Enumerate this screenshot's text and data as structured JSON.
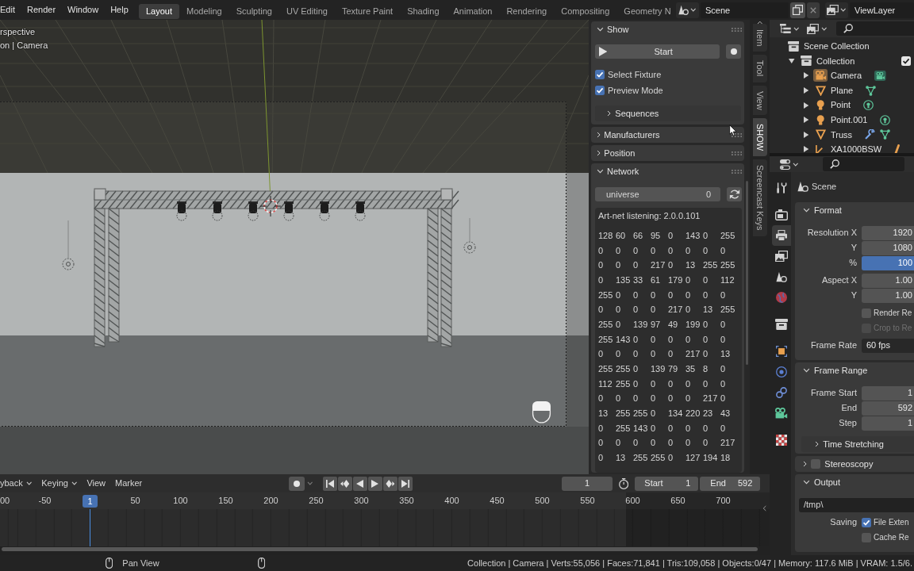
{
  "top_bar": {
    "menus": [
      "Edit",
      "Render",
      "Window",
      "Help"
    ],
    "workspaces": [
      {
        "label": "Layout",
        "selected": true
      },
      {
        "label": "Modeling",
        "selected": false
      },
      {
        "label": "Sculpting",
        "selected": false
      },
      {
        "label": "UV Editing",
        "selected": false
      },
      {
        "label": "Texture Paint",
        "selected": false
      },
      {
        "label": "Shading",
        "selected": false
      },
      {
        "label": "Animation",
        "selected": false
      },
      {
        "label": "Rendering",
        "selected": false
      },
      {
        "label": "Compositing",
        "selected": false
      },
      {
        "label": "Geometry N",
        "selected": false
      }
    ],
    "scene": "Scene",
    "view_layer": "ViewLayer"
  },
  "viewport": {
    "overlay_lines": [
      "rspective",
      "on | Camera"
    ]
  },
  "sidebar": {
    "panels": [
      {
        "title": "Show",
        "expanded": true,
        "button": "Start",
        "checkboxes": [
          {
            "label": "Select Fixture",
            "checked": true
          },
          {
            "label": "Preview Mode",
            "checked": true
          }
        ],
        "subpanels": [
          {
            "title": "Sequences",
            "expanded": false
          }
        ]
      },
      {
        "title": "Manufacturers",
        "expanded": false
      },
      {
        "title": "Position",
        "expanded": false
      },
      {
        "title": "Network",
        "expanded": true,
        "universe": {
          "label": "universe",
          "value": "0"
        },
        "status": "Art-net listening: 2.0.0.101",
        "channels": [
          [
            "128",
            "60",
            "66",
            "95",
            "0",
            "143",
            "0",
            "255"
          ],
          [
            "0",
            "0",
            "0",
            "0",
            "0",
            "0",
            "0",
            "0"
          ],
          [
            "0",
            "0",
            "0",
            "217",
            "0",
            "13",
            "255",
            "255"
          ],
          [
            "0",
            "135",
            "33",
            "61",
            "179",
            "0",
            "0",
            "112"
          ],
          [
            "255",
            "0",
            "0",
            "0",
            "0",
            "0",
            "0",
            "0"
          ],
          [
            "0",
            "0",
            "0",
            "0",
            "217",
            "0",
            "13",
            "255"
          ],
          [
            "255",
            "0",
            "139",
            "97",
            "49",
            "199",
            "0",
            "0"
          ],
          [
            "255",
            "143",
            "0",
            "0",
            "0",
            "0",
            "0",
            "0"
          ],
          [
            "0",
            "0",
            "0",
            "0",
            "0",
            "217",
            "0",
            "13"
          ],
          [
            "255",
            "255",
            "0",
            "139",
            "79",
            "35",
            "8",
            "0"
          ],
          [
            "112",
            "255",
            "0",
            "0",
            "0",
            "0",
            "0",
            "0"
          ],
          [
            "0",
            "0",
            "0",
            "0",
            "0",
            "0",
            "217",
            "0"
          ],
          [
            "13",
            "255",
            "255",
            "0",
            "134",
            "220",
            "23",
            "43"
          ],
          [
            "0",
            "255",
            "143",
            "0",
            "0",
            "0",
            "0",
            "0"
          ],
          [
            "0",
            "0",
            "0",
            "0",
            "0",
            "0",
            "0",
            "217"
          ],
          [
            "0",
            "13",
            "255",
            "255",
            "0",
            "127",
            "194",
            "18"
          ]
        ]
      }
    ],
    "tabs": [
      {
        "label": "Item",
        "selected": false
      },
      {
        "label": "Tool",
        "selected": false
      },
      {
        "label": "View",
        "selected": false
      },
      {
        "label": "SHOW",
        "selected": true
      },
      {
        "label": "Screencast Keys",
        "selected": false
      }
    ]
  },
  "outliner": {
    "items": [
      {
        "label": "Scene Collection",
        "kind": "scene_collection",
        "children": [
          {
            "label": "Collection",
            "kind": "collection",
            "expanded": true,
            "checked": true,
            "children": [
              {
                "label": "Camera",
                "kind": "camera",
                "expanded": false
              },
              {
                "label": "Plane",
                "kind": "mesh",
                "expanded": false
              },
              {
                "label": "Point",
                "kind": "light",
                "expanded": false
              },
              {
                "label": "Point.001",
                "kind": "light",
                "expanded": false
              },
              {
                "label": "Truss",
                "kind": "mesh_modified",
                "expanded": false
              },
              {
                "label": "XA1000BSW",
                "kind": "armature",
                "expanded": false
              }
            ]
          }
        ]
      }
    ]
  },
  "properties": {
    "tabs": [
      {
        "kind": "tool",
        "selected": false
      },
      {
        "kind": "render",
        "selected": false
      },
      {
        "kind": "output",
        "selected": true
      },
      {
        "kind": "view_layer",
        "selected": false
      },
      {
        "kind": "scene",
        "selected": false
      },
      {
        "kind": "world",
        "selected": false
      },
      {
        "kind": "collection",
        "selected": false
      },
      {
        "kind": "object",
        "selected": false
      },
      {
        "kind": "physics",
        "selected": false
      },
      {
        "kind": "constraints",
        "selected": false
      },
      {
        "kind": "data",
        "selected": false
      },
      {
        "kind": "texture",
        "selected": false
      }
    ],
    "context": "Scene",
    "panels": [
      {
        "kind": "plain",
        "title": "Format",
        "expanded": true,
        "groups": [
          [
            {
              "kind": "number",
              "label": "Resolution X",
              "value": "1920"
            },
            {
              "kind": "number",
              "label": "Y",
              "value": "1080"
            },
            {
              "kind": "slider",
              "label": "%",
              "value": "100",
              "level": 1
            }
          ],
          [
            {
              "kind": "number",
              "label": "Aspect X",
              "value": "1.00"
            },
            {
              "kind": "number",
              "label": "Y",
              "value": "1.00"
            }
          ],
          [
            {
              "kind": "checkbox",
              "label": "Render Re",
              "checked": false,
              "disabled": false
            },
            {
              "kind": "checkbox",
              "label": "Crop to Re",
              "checked": false,
              "disabled": true
            }
          ],
          [
            {
              "kind": "dropdown",
              "label": "Frame Rate",
              "value": "60 fps"
            }
          ]
        ]
      },
      {
        "kind": "plain",
        "title": "Frame Range",
        "expanded": true,
        "groups": [
          [
            {
              "kind": "number",
              "label": "Frame Start",
              "value": "1"
            },
            {
              "kind": "number",
              "label": "End",
              "value": "592"
            },
            {
              "kind": "number",
              "label": "Step",
              "value": "1"
            }
          ]
        ],
        "subpanels": [
          {
            "title": "Time Stretching",
            "expanded": false
          }
        ]
      },
      {
        "kind": "toggle",
        "title": "Stereoscopy",
        "expanded": false,
        "checked": false
      },
      {
        "kind": "plain",
        "title": "Output",
        "expanded": true,
        "groups": [
          [
            {
              "kind": "path",
              "value": "/tmp\\"
            }
          ],
          [
            {
              "kind": "checkbox",
              "heading": "Saving",
              "label": "File Exten",
              "checked": true,
              "disabled": false
            },
            {
              "kind": "checkbox",
              "label": "Cache Re",
              "checked": false,
              "disabled": false
            }
          ]
        ]
      }
    ]
  },
  "timeline": {
    "menus": [
      {
        "label": "yback",
        "dropdown": true
      },
      {
        "label": "Keying",
        "dropdown": true
      },
      {
        "label": "View",
        "dropdown": false
      },
      {
        "label": "Marker",
        "dropdown": false
      }
    ],
    "current_frame": "1",
    "start": {
      "label": "Start",
      "value": "1"
    },
    "end": {
      "label": "End",
      "value": "592"
    },
    "ruler": [
      {
        "kind": "tick",
        "label": "00"
      },
      {
        "kind": "tick",
        "label": "-50"
      },
      {
        "kind": "playhead",
        "label": "1"
      },
      {
        "kind": "tick",
        "label": "50"
      },
      {
        "kind": "tick",
        "label": "100"
      },
      {
        "kind": "tick",
        "label": "150"
      },
      {
        "kind": "tick",
        "label": "200"
      },
      {
        "kind": "tick",
        "label": "250"
      },
      {
        "kind": "tick",
        "label": "300"
      },
      {
        "kind": "tick",
        "label": "350"
      },
      {
        "kind": "tick",
        "label": "400"
      },
      {
        "kind": "tick",
        "label": "450"
      },
      {
        "kind": "tick",
        "label": "500"
      },
      {
        "kind": "tick",
        "label": "550"
      },
      {
        "kind": "tick",
        "label": "600"
      },
      {
        "kind": "tick",
        "label": "650"
      },
      {
        "kind": "tick",
        "label": "700"
      }
    ]
  },
  "status_bar": {
    "hint": "Pan View",
    "stats": "Collection | Camera | Verts:55,056 | Faces:71,841 | Tris:109,058 | Objects:0/47 | Memory: 117.6 MiB | VRAM: 1.5/6."
  }
}
